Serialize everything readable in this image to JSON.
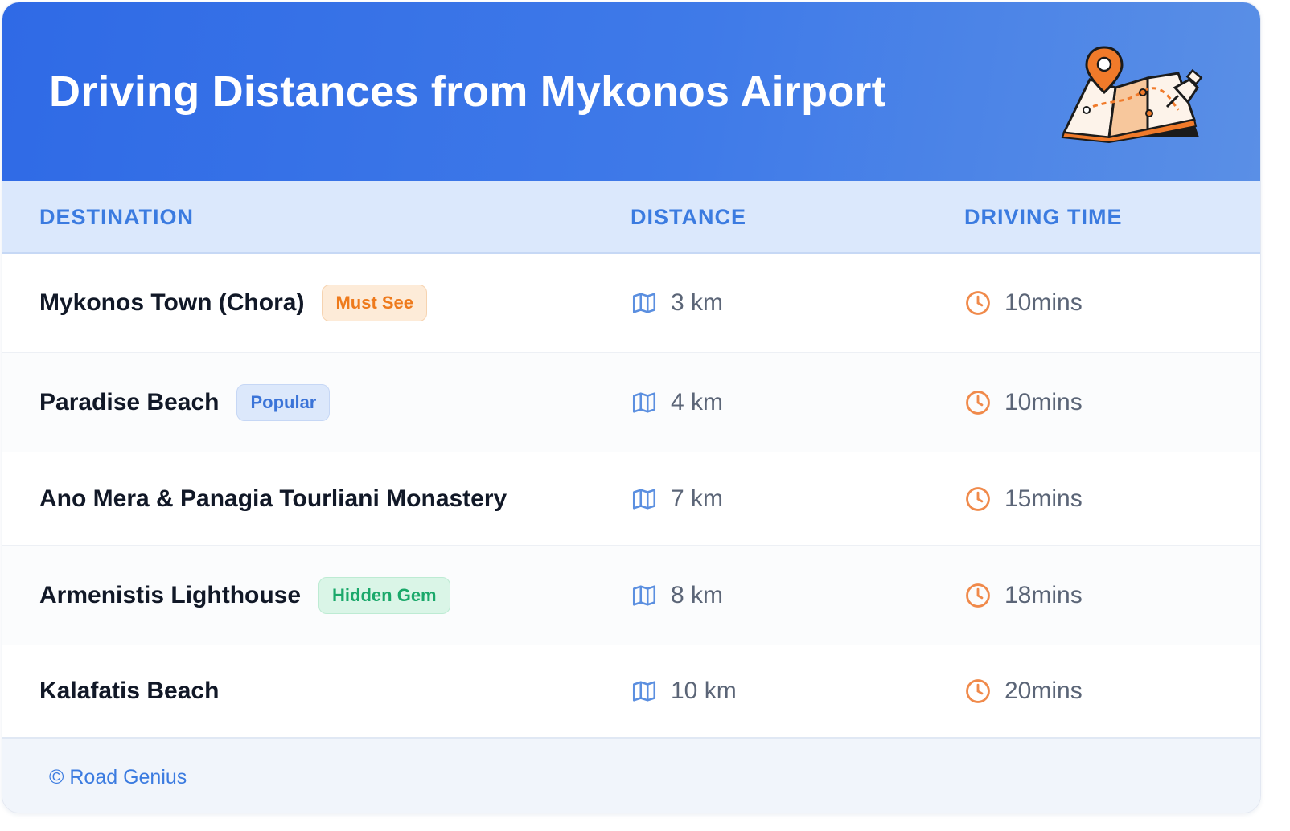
{
  "header": {
    "title": "Driving Distances from Mykonos Airport",
    "illustration_icon": "map-with-pins-icon"
  },
  "columns": {
    "destination": "DESTINATION",
    "distance": "DISTANCE",
    "driving_time": "DRIVING TIME"
  },
  "rows": [
    {
      "destination": "Mykonos Town (Chora)",
      "badge": "Must See",
      "badge_color": "#ee7a1c",
      "distance": "3 km",
      "time": "10mins"
    },
    {
      "destination": "Paradise Beach",
      "badge": "Popular",
      "badge_color": "#3b74d8",
      "distance": "4 km",
      "time": "10mins"
    },
    {
      "destination": "Ano Mera & Panagia Tourliani Monastery",
      "badge": "",
      "distance": "7 km",
      "time": "15mins"
    },
    {
      "destination": "Armenistis Lighthouse",
      "badge": "Hidden Gem",
      "badge_color": "#1aa86a",
      "distance": "8 km",
      "time": "18mins"
    },
    {
      "destination": "Kalafatis Beach",
      "badge": "",
      "distance": "10 km",
      "time": "20mins"
    }
  ],
  "icons": {
    "distance": "map-icon",
    "time": "clock-icon"
  },
  "footer": {
    "text": "© Road Genius"
  },
  "colors": {
    "header_gradient_start": "#2f6ae6",
    "header_gradient_end": "#5a8fe6",
    "accent": "#3b7be0",
    "clock": "#f08a4b"
  }
}
